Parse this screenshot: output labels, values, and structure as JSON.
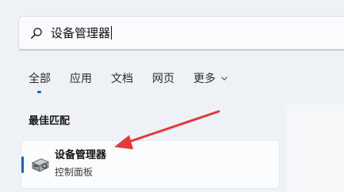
{
  "search": {
    "query": "设备管理器"
  },
  "tabs": [
    {
      "label": "全部"
    },
    {
      "label": "应用"
    },
    {
      "label": "文档"
    },
    {
      "label": "网页"
    },
    {
      "label": "更多"
    }
  ],
  "best_match": {
    "section_title": "最佳匹配",
    "result": {
      "title": "设备管理器",
      "subtitle": "控制面板"
    }
  },
  "colors": {
    "accent": "#0a64c2",
    "annotation_arrow": "#e23a3a"
  },
  "icons": {
    "search": "search-icon",
    "more": "chevron-down-icon",
    "app": "device-manager-icon"
  }
}
